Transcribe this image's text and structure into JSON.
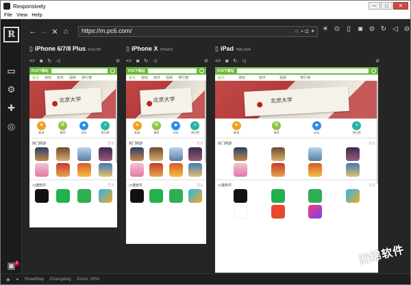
{
  "window": {
    "title": "Responsively",
    "minimize": "─",
    "maximize": "□",
    "close": "✕"
  },
  "menu": [
    "File",
    "View",
    "Help"
  ],
  "toolbar": {
    "url": "https://m.pc6.com/"
  },
  "devices": [
    {
      "name": "iPhone 6/7/8 Plus",
      "res": "414x736"
    },
    {
      "name": "iPhone X",
      "res": "375x812"
    },
    {
      "name": "iPad",
      "res": "768x1024"
    }
  ],
  "site": {
    "name": "PC6下载站",
    "tabs": [
      "首页",
      "游戏",
      "软件",
      "视频",
      "排行榜"
    ],
    "tabs_ipad": [
      "首页",
      "游戏",
      "软件",
      "视频",
      "排行榜"
    ],
    "categories": [
      {
        "label": "新游",
        "color": "#f0a21f"
      },
      {
        "label": "推荐",
        "color": "#8cc63e"
      },
      {
        "label": "必玩",
        "color": "#2d8ee8"
      },
      {
        "label": "排行榜",
        "color": "#27b4a4"
      }
    ],
    "hot_games_title": "热门网游",
    "hot_apps_title": "火爆软件",
    "more": "更多"
  },
  "status": {
    "roadmap": "RoadMap",
    "changelog": "Changelog",
    "zoom": "Zoom: 60%"
  },
  "watermark": "海绵软件",
  "notification_count": "2"
}
